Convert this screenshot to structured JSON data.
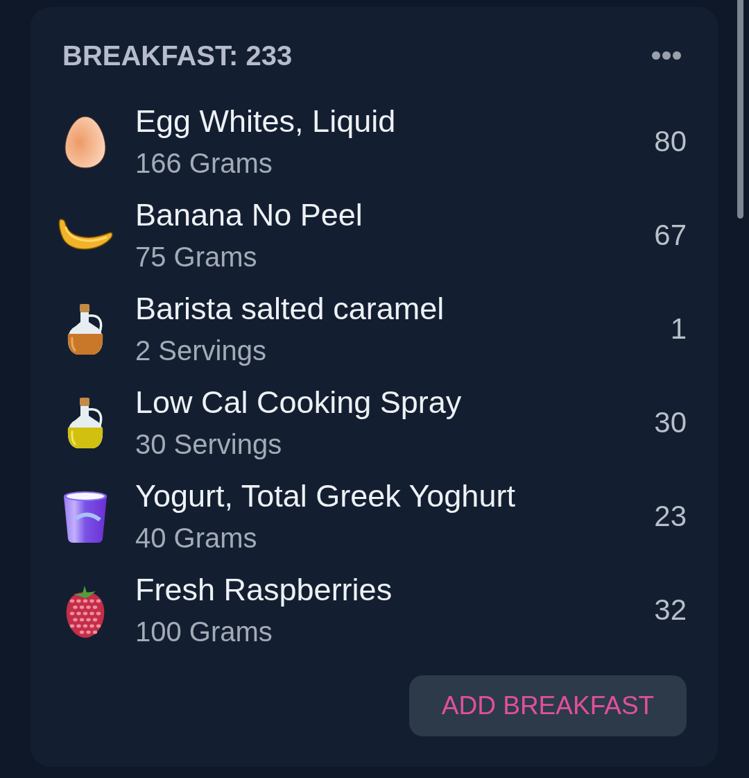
{
  "meal": {
    "title": "BREAKFAST: 233"
  },
  "items": [
    {
      "kind": "egg",
      "name": "Egg Whites, Liquid",
      "amount": "166 Grams",
      "calories": "80"
    },
    {
      "kind": "banana",
      "name": "Banana No Peel",
      "amount": "75 Grams",
      "calories": "67"
    },
    {
      "kind": "syrup",
      "name": "Barista salted caramel",
      "amount": "2 Servings",
      "calories": "1"
    },
    {
      "kind": "oil",
      "name": "Low Cal Cooking Spray",
      "amount": "30 Servings",
      "calories": "30"
    },
    {
      "kind": "yogurt",
      "name": "Yogurt, Total Greek Yoghurt",
      "amount": "40 Grams",
      "calories": "23"
    },
    {
      "kind": "raspberry",
      "name": "Fresh Raspberries",
      "amount": "100 Grams",
      "calories": "32"
    }
  ],
  "add_button": {
    "label": "ADD BREAKFAST"
  }
}
